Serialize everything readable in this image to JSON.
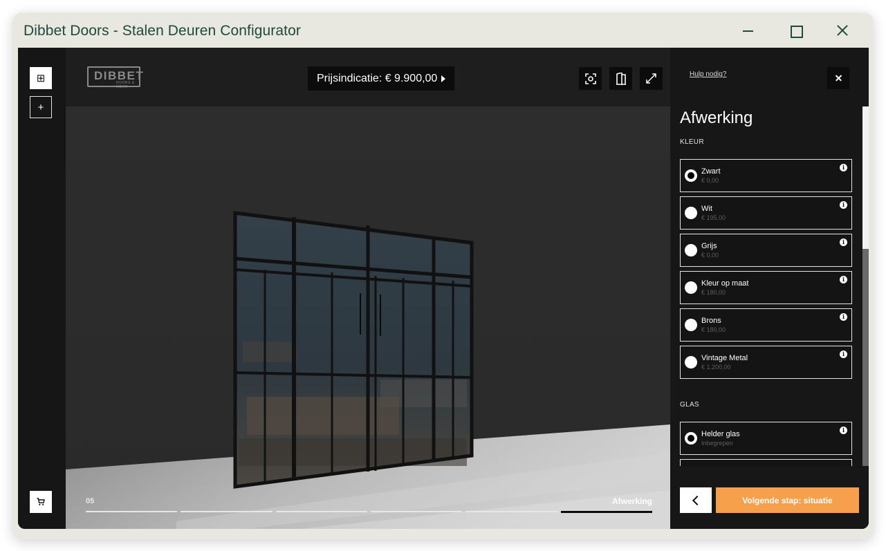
{
  "window": {
    "title": "Dibbet Doors - Stalen Deuren Configurator"
  },
  "rail": {
    "top_buttons": [
      {
        "icon": "grid-icon",
        "glyph": "⊞"
      },
      {
        "icon": "plus-icon",
        "glyph": "+"
      }
    ],
    "cart_icon": "cart-icon"
  },
  "viewport": {
    "logo": {
      "text": "DIBBET",
      "sub": "DOORS & MORE"
    },
    "price_label": "Prijsindicatie: € 9.900,00",
    "tools": [
      {
        "icon": "screenshot-icon",
        "glyph": "⊡"
      },
      {
        "icon": "door-icon",
        "glyph": "⌷"
      },
      {
        "icon": "fullscreen-icon",
        "glyph": "⤢"
      }
    ],
    "step_number": "05",
    "step_name": "Afwerking",
    "progress": {
      "total": 6,
      "current": 6
    }
  },
  "panel": {
    "help_link": "Hulp nodig?",
    "title": "Afwerking",
    "sections": [
      {
        "label": "KLEUR",
        "options": [
          {
            "name": "Zwart",
            "price": "€ 0,00",
            "selected": true
          },
          {
            "name": "Wit",
            "price": "€ 195,00",
            "selected": false
          },
          {
            "name": "Grijs",
            "price": "€ 0,00",
            "selected": false
          },
          {
            "name": "Kleur op maat",
            "price": "€ 180,00",
            "selected": false
          },
          {
            "name": "Brons",
            "price": "€ 180,00",
            "selected": false
          },
          {
            "name": "Vintage Metal",
            "price": "€ 1.200,00",
            "selected": false
          }
        ]
      },
      {
        "label": "GLAS",
        "options": [
          {
            "name": "Helder glas",
            "price": "Inbegrepen",
            "selected": true
          }
        ]
      }
    ],
    "next_button": "Volgende stap: situatie",
    "colors": {
      "accent": "#f6a04c",
      "panel_bg": "#171717"
    }
  }
}
